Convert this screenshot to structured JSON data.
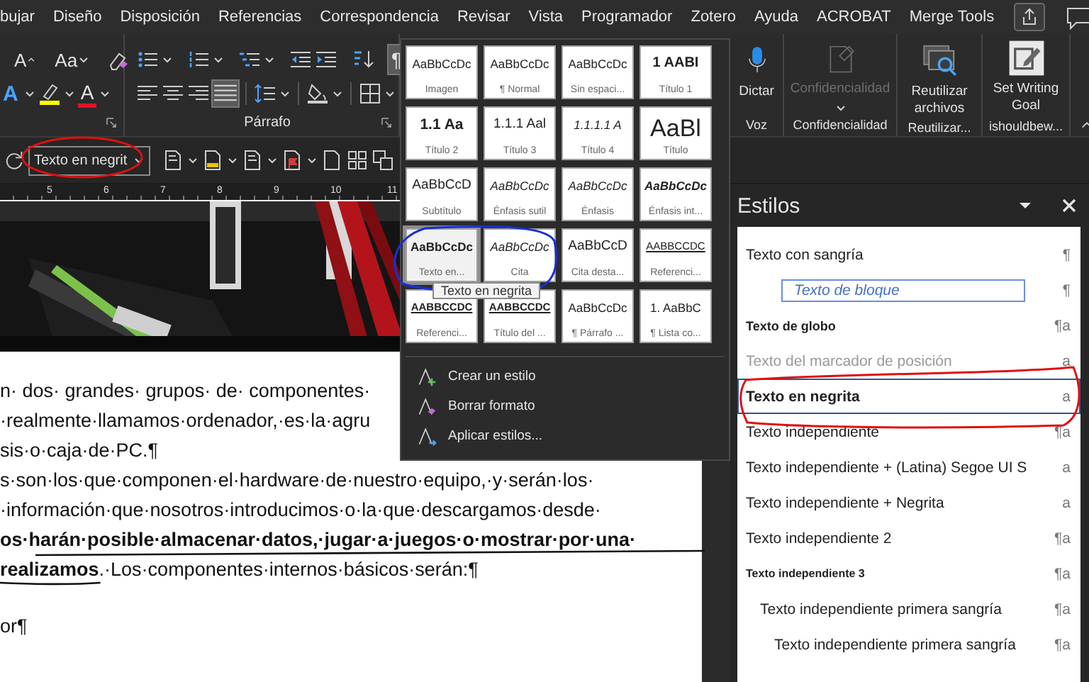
{
  "menu_tabs": [
    {
      "label": "bujar",
      "selected": false
    },
    {
      "label": "Diseño",
      "selected": false
    },
    {
      "label": "Disposición",
      "selected": false
    },
    {
      "label": "Referencias",
      "selected": false
    },
    {
      "label": "Correspondencia",
      "selected": false
    },
    {
      "label": "Revisar",
      "selected": false
    },
    {
      "label": "Vista",
      "selected": false
    },
    {
      "label": "Programador",
      "selected": false
    },
    {
      "label": "Zotero",
      "selected": false
    },
    {
      "label": "Ayuda",
      "selected": false
    },
    {
      "label": "ACROBAT",
      "selected": false
    },
    {
      "label": "Merge Tools",
      "selected": false
    }
  ],
  "ribbon": {
    "font_group": {
      "grow_font": "A",
      "change_case": "Aa",
      "text_effects": "A",
      "font_color": "A"
    },
    "paragraph_group": {
      "label": "Párrafo",
      "justify_on": true,
      "show_marks": {
        "label": "¶",
        "on": true
      }
    },
    "voice": {
      "button": "Dictar",
      "group": "Voz"
    },
    "sensitivity": {
      "button": "Confidencialidad",
      "group": "Confidencialidad",
      "disabled": true
    },
    "reuse": {
      "button": "Reutilizar archivos",
      "group": "Reutilizar..."
    },
    "writing_goal": {
      "button": "Set Writing Goal",
      "group": "ishouldbew..."
    }
  },
  "quick_toolbar": {
    "style_box": "Texto en negrit"
  },
  "ruler": [
    "5",
    "6",
    "7",
    "8",
    "9",
    "10",
    "11"
  ],
  "document": {
    "paragraphs": [
      {
        "lines": [
          {
            "text": "n· dos· grandes· grupos· de· componentes·",
            "kind": "plain"
          },
          {
            "text": "·realmente·llamamos·ordenador,·es·la·agru",
            "kind": "plain"
          },
          {
            "text": "sis·o·caja·de·PC.¶",
            "kind": "plain"
          }
        ]
      },
      {
        "lines": [
          {
            "text": "s·son·los·que·componen·el·hardware·de·nuestro·equipo,·y·serán·los·",
            "kind": "plain"
          },
          {
            "text": "·información·que·nosotros·introducimos·o·la·que·descargamos·desde·",
            "kind": "plain"
          },
          {
            "text": "os·harán·posible·almacenar·datos,·jugar·a·juegos·o·mostrar·por·una·",
            "kind": "bold"
          },
          {
            "text": "**realizamos**.·Los·componentes·internos·básicos·serán:¶",
            "kind": "plain"
          }
        ]
      },
      {
        "lines": [
          {
            "text": "or¶",
            "kind": "plain"
          }
        ]
      }
    ]
  },
  "style_gallery": {
    "tiles": [
      {
        "preview": "AaBbCcDc",
        "label": "Imagen",
        "kind": "plain",
        "selected": false
      },
      {
        "preview": "AaBbCcDc",
        "label": "¶ Normal",
        "kind": "plain",
        "selected": false
      },
      {
        "preview": "AaBbCcDc",
        "label": "Sin espaci...",
        "kind": "plain",
        "selected": false
      },
      {
        "preview": "1 AABI",
        "label": "Título 1",
        "kind": "caps",
        "selected": false
      },
      {
        "preview": "1.1 Aa",
        "label": "Título 2",
        "kind": "heading",
        "selected": false
      },
      {
        "preview": "1.1.1 Aal",
        "label": "Título 3",
        "kind": "mid",
        "selected": false
      },
      {
        "preview": "1.1.1.1 A",
        "label": "Título 4",
        "kind": "italic",
        "selected": false
      },
      {
        "preview": "AaBl",
        "label": "Título",
        "kind": "large",
        "selected": false
      },
      {
        "preview": "AaBbCcD",
        "label": "Subtítulo",
        "kind": "mid",
        "selected": false
      },
      {
        "preview": "AaBbCcDc",
        "label": "Énfasis sutil",
        "kind": "italic",
        "selected": false
      },
      {
        "preview": "AaBbCcDc",
        "label": "Énfasis",
        "kind": "italic",
        "selected": false
      },
      {
        "preview": "AaBbCcDc",
        "label": "Énfasis int...",
        "kind": "bolditalic",
        "selected": false
      },
      {
        "preview": "AaBbCcDc",
        "label": "Texto en...",
        "kind": "bold",
        "selected": true
      },
      {
        "preview": "AaBbCcDc",
        "label": "Cita",
        "kind": "italic",
        "selected": false
      },
      {
        "preview": "AaBbCcD",
        "label": "Cita desta...",
        "kind": "mid",
        "selected": false
      },
      {
        "preview": "AABBCCDC",
        "label": "Referenci...",
        "kind": "smallcaps",
        "selected": false
      },
      {
        "preview": "AABBCCDC",
        "label": "Referenci...",
        "kind": "boldcaps",
        "selected": false
      },
      {
        "preview": "AABBCCDC",
        "label": "Título del ...",
        "kind": "boldcaps",
        "selected": false
      },
      {
        "preview": "AaBbCcDc",
        "label": "¶ Párrafo ...",
        "kind": "plain",
        "selected": false
      },
      {
        "preview": "1. AaBbC",
        "label": "¶ Lista co...",
        "kind": "plain",
        "selected": false
      }
    ],
    "menu": [
      {
        "label": "Crear un estilo",
        "kind": "new"
      },
      {
        "label": "Borrar formato",
        "kind": "clear"
      },
      {
        "label": "Aplicar estilos...",
        "kind": "apply"
      }
    ],
    "tooltip": "Texto en negrita"
  },
  "styles_pane": {
    "title": "Estilos",
    "items": [
      {
        "name": "Texto con sangría",
        "mark": "¶",
        "kind": "plain",
        "selected": false
      },
      {
        "name": "Texto de bloque",
        "mark": "¶",
        "kind": "block",
        "selected": false
      },
      {
        "name": "Texto de globo",
        "mark": "¶a",
        "kind": "globe",
        "selected": false
      },
      {
        "name": "Texto del marcador de posición",
        "mark": "a",
        "kind": "placeholder",
        "selected": false
      },
      {
        "name": "Texto en negrita",
        "mark": "a",
        "kind": "bold",
        "selected": true
      },
      {
        "name": "Texto independiente",
        "mark": "¶a",
        "kind": "plain",
        "selected": false
      },
      {
        "name": "Texto independiente + (Latina) Segoe UI S",
        "mark": "a",
        "kind": "plain",
        "selected": false
      },
      {
        "name": "Texto independiente + Negrita",
        "mark": "a",
        "kind": "plain",
        "selected": false
      },
      {
        "name": "Texto independiente 2",
        "mark": "¶a",
        "kind": "plain",
        "selected": false
      },
      {
        "name": "Texto independiente 3",
        "mark": "¶a",
        "kind": "tiny",
        "selected": false
      },
      {
        "name": "Texto independiente primera sangría",
        "mark": "¶a",
        "kind": "indent",
        "selected": false
      },
      {
        "name": "Texto independiente primera sangría",
        "mark": "¶a",
        "kind": "indent2",
        "selected": false
      }
    ]
  }
}
